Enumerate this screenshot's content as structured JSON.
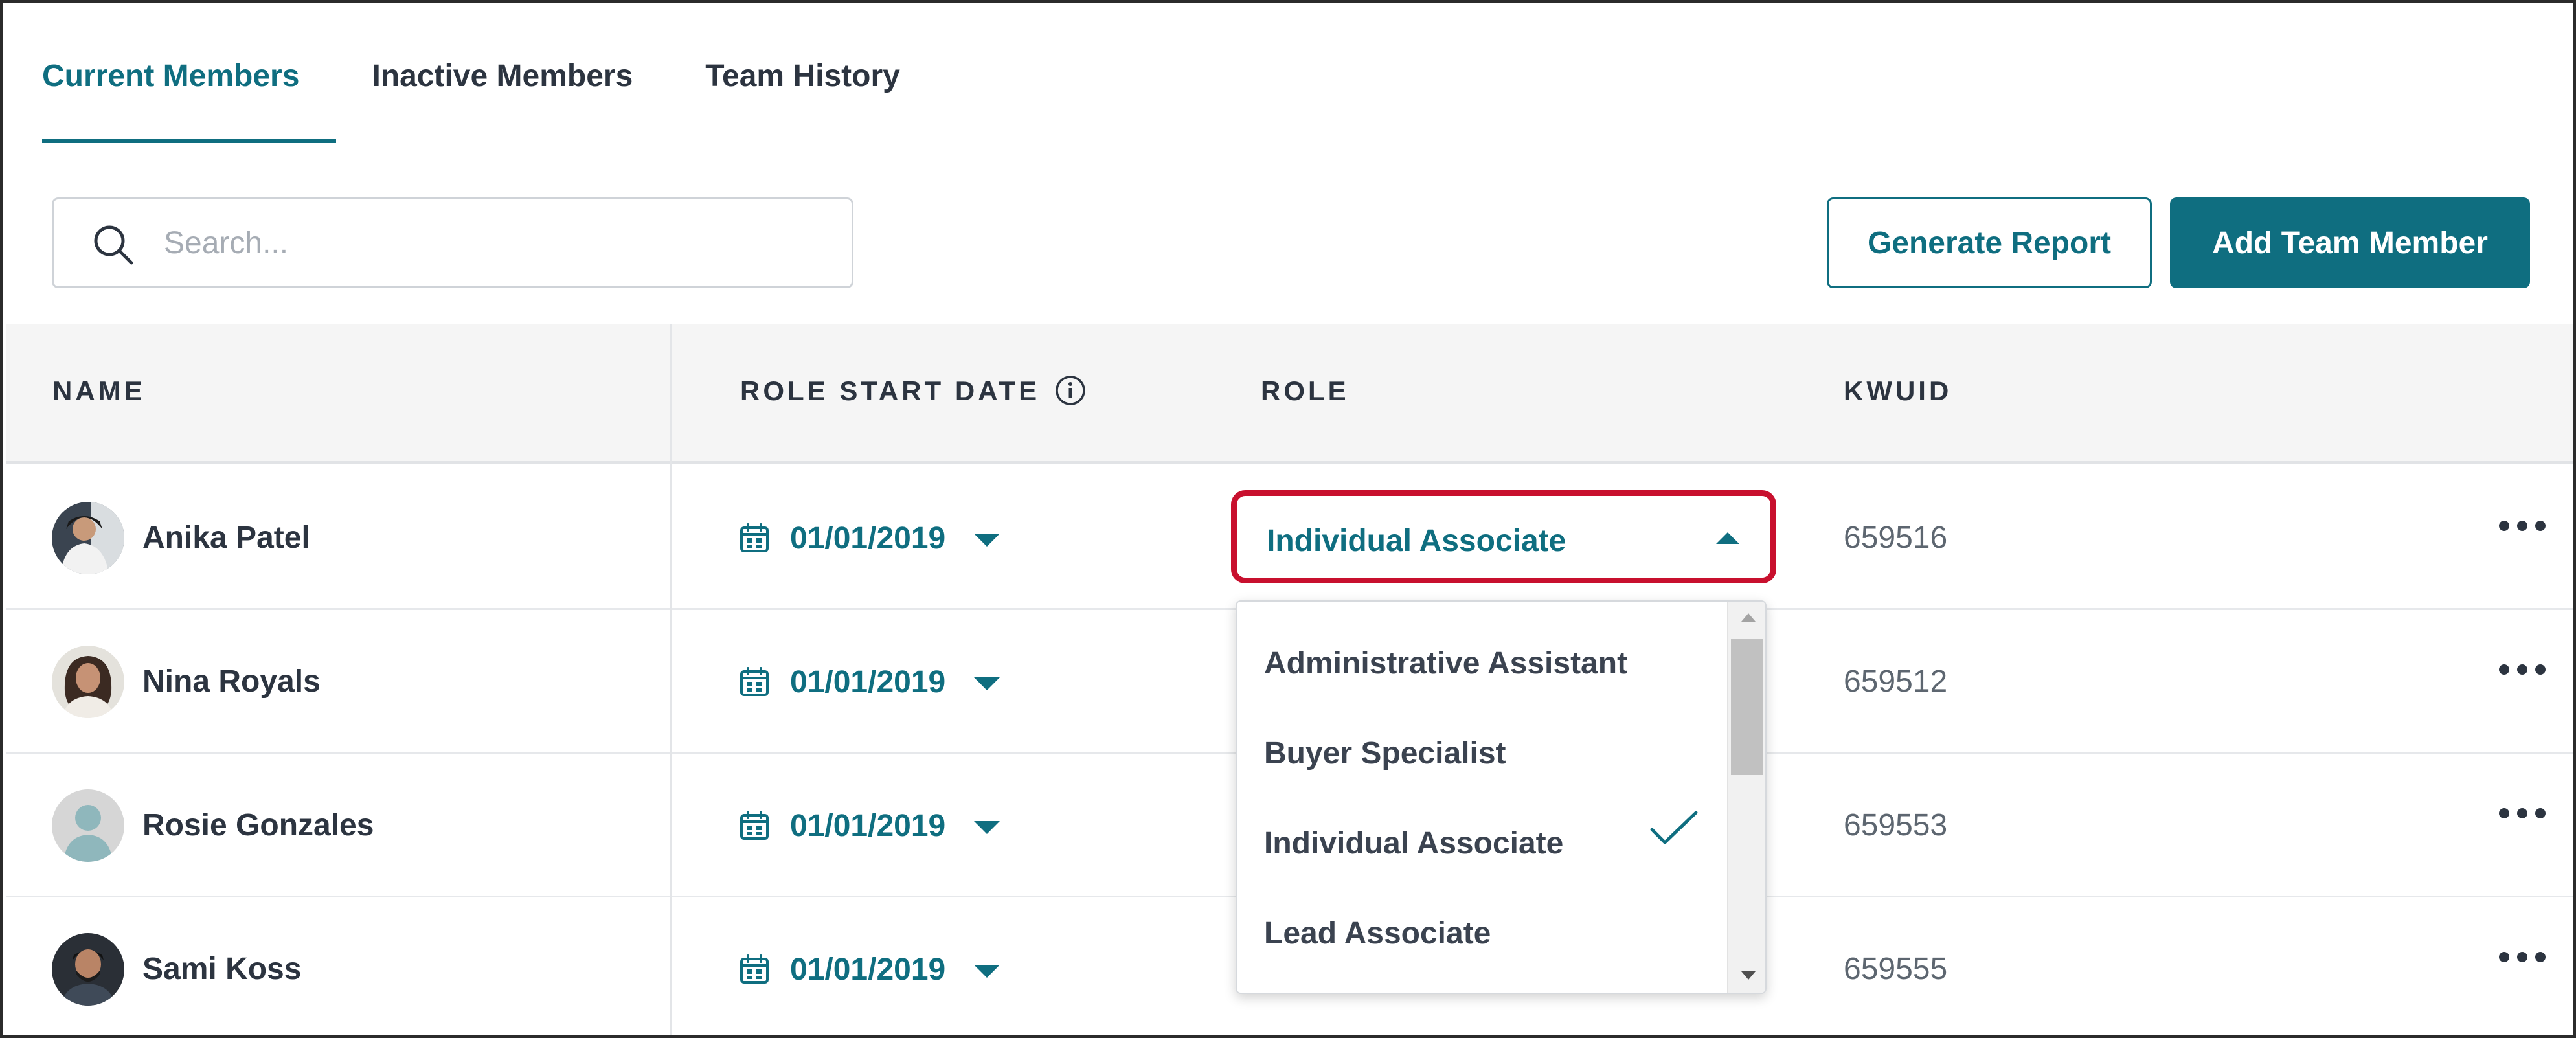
{
  "tabs": [
    {
      "label": "Current Members",
      "active": true
    },
    {
      "label": "Inactive Members",
      "active": false
    },
    {
      "label": "Team History",
      "active": false
    }
  ],
  "search": {
    "placeholder": "Search...",
    "value": ""
  },
  "buttons": {
    "generate_report": "Generate Report",
    "add_team_member": "Add Team Member"
  },
  "table": {
    "headers": {
      "name": "NAME",
      "role_start_date": "ROLE START DATE",
      "role": "ROLE",
      "kwuid": "KWUID"
    },
    "rows": [
      {
        "name": "Anika Patel",
        "date": "01/01/2019",
        "role": "Individual Associate",
        "kwuid": "659516"
      },
      {
        "name": "Nina Royals",
        "date": "01/01/2019",
        "role": "",
        "kwuid": "659512"
      },
      {
        "name": "Rosie Gonzales",
        "date": "01/01/2019",
        "role": "",
        "kwuid": "659553"
      },
      {
        "name": "Sami Koss",
        "date": "01/01/2019",
        "role": "",
        "kwuid": "659555"
      }
    ]
  },
  "role_dropdown": {
    "selected": "Individual Associate",
    "options": [
      "Administrative Assistant",
      "Buyer Specialist",
      "Individual Associate",
      "Lead Associate"
    ]
  },
  "icons": {
    "search": "search-icon",
    "info": "info-icon",
    "calendar": "calendar-icon",
    "more": "more-options-icon",
    "check": "checkmark-icon"
  },
  "colors": {
    "accent": "#0f6e80",
    "highlight": "#c8102e",
    "text": "#2c3440",
    "muted": "#5d6670"
  }
}
